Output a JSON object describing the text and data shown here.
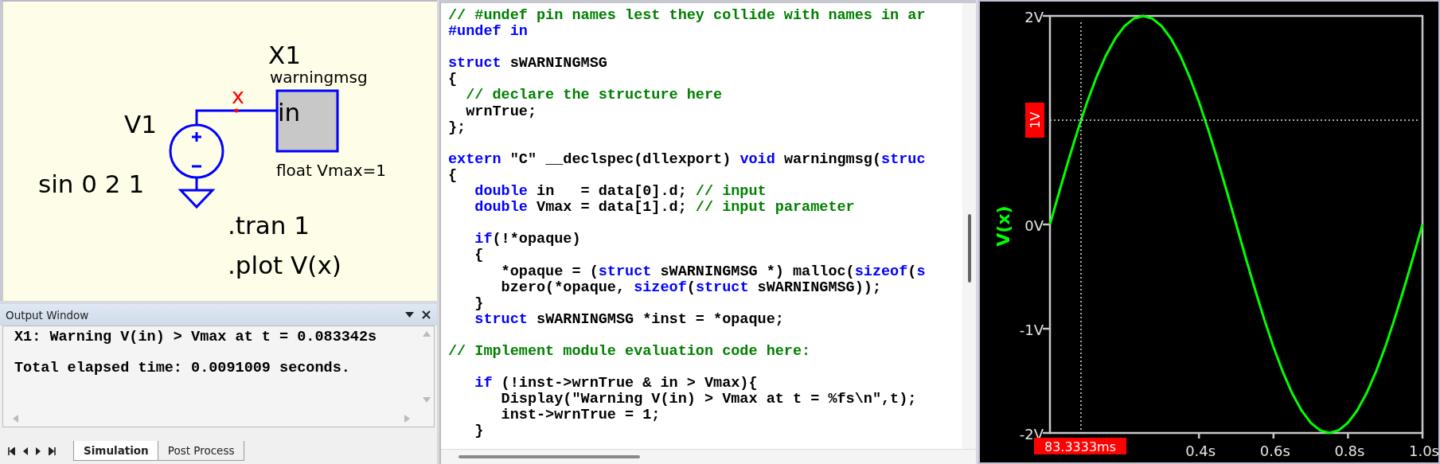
{
  "schematic": {
    "components": [
      {
        "kind": "voltage_source",
        "name": "V1",
        "value": "sin 0 2 1"
      },
      {
        "kind": "block",
        "name": "X1",
        "model": "warningmsg",
        "pin": "in",
        "params": "float Vmax=1"
      }
    ],
    "net_label": "x",
    "directives": [
      ".tran 1",
      ".plot V(x)"
    ]
  },
  "output_window": {
    "title": "Output Window",
    "lines": [
      "X1: Warning V(in) > Vmax at t = 0.083342s",
      "Total elapsed time: 0.0091009 seconds."
    ],
    "tabs": [
      {
        "label": "Simulation",
        "selected": true
      },
      {
        "label": "Post Process",
        "selected": false
      }
    ]
  },
  "code_editor": {
    "lines": [
      {
        "kind": "code",
        "tokens": [
          {
            "kind": "comment",
            "text": "// #undef pin names lest they collide with names in ar"
          }
        ]
      },
      {
        "kind": "code",
        "tokens": [
          {
            "kind": "keyword",
            "text": "#undef in"
          }
        ]
      },
      {
        "kind": "blank"
      },
      {
        "kind": "code",
        "tokens": [
          {
            "kind": "keyword",
            "text": "struct"
          },
          {
            "kind": "plain",
            "text": " sWARNINGMSG"
          }
        ]
      },
      {
        "kind": "code",
        "tokens": [
          {
            "kind": "plain",
            "text": "{"
          }
        ]
      },
      {
        "kind": "code",
        "tokens": [
          {
            "kind": "comment",
            "text": "  // declare the structure here"
          }
        ]
      },
      {
        "kind": "code",
        "tokens": [
          {
            "kind": "plain",
            "text": "  wrnTrue;"
          }
        ]
      },
      {
        "kind": "code",
        "tokens": [
          {
            "kind": "plain",
            "text": "};"
          }
        ]
      },
      {
        "kind": "blank"
      },
      {
        "kind": "code",
        "tokens": [
          {
            "kind": "keyword",
            "text": "extern"
          },
          {
            "kind": "plain",
            "text": " \"C\" __declspec(dllexport) "
          },
          {
            "kind": "keyword",
            "text": "void"
          },
          {
            "kind": "plain",
            "text": " warningmsg("
          },
          {
            "kind": "keyword",
            "text": "struc"
          }
        ]
      },
      {
        "kind": "code",
        "tokens": [
          {
            "kind": "plain",
            "text": "{"
          }
        ]
      },
      {
        "kind": "code",
        "tokens": [
          {
            "kind": "keyword",
            "text": "   double"
          },
          {
            "kind": "plain",
            "text": " in   = data[0].d; "
          },
          {
            "kind": "comment",
            "text": "// input"
          }
        ]
      },
      {
        "kind": "code",
        "tokens": [
          {
            "kind": "keyword",
            "text": "   double"
          },
          {
            "kind": "plain",
            "text": " Vmax = data[1].d; "
          },
          {
            "kind": "comment",
            "text": "// input parameter"
          }
        ]
      },
      {
        "kind": "blank"
      },
      {
        "kind": "code",
        "tokens": [
          {
            "kind": "keyword",
            "text": "   if"
          },
          {
            "kind": "plain",
            "text": "(!*opaque)"
          }
        ]
      },
      {
        "kind": "code",
        "tokens": [
          {
            "kind": "plain",
            "text": "   {"
          }
        ]
      },
      {
        "kind": "code",
        "tokens": [
          {
            "kind": "plain",
            "text": "      *opaque = ("
          },
          {
            "kind": "keyword",
            "text": "struct"
          },
          {
            "kind": "plain",
            "text": " sWARNINGMSG *) malloc("
          },
          {
            "kind": "keyword",
            "text": "sizeof"
          },
          {
            "kind": "plain",
            "text": "("
          },
          {
            "kind": "keyword",
            "text": "s"
          }
        ]
      },
      {
        "kind": "code",
        "tokens": [
          {
            "kind": "plain",
            "text": "      bzero(*opaque, "
          },
          {
            "kind": "keyword",
            "text": "sizeof"
          },
          {
            "kind": "plain",
            "text": "("
          },
          {
            "kind": "keyword",
            "text": "struct"
          },
          {
            "kind": "plain",
            "text": " sWARNINGMSG));"
          }
        ]
      },
      {
        "kind": "code",
        "tokens": [
          {
            "kind": "plain",
            "text": "   }"
          }
        ]
      },
      {
        "kind": "code",
        "tokens": [
          {
            "kind": "keyword",
            "text": "   struct"
          },
          {
            "kind": "plain",
            "text": " sWARNINGMSG *inst = *opaque;"
          }
        ]
      },
      {
        "kind": "blank"
      },
      {
        "kind": "code",
        "tokens": [
          {
            "kind": "comment",
            "text": "// Implement module evaluation code here:"
          }
        ]
      },
      {
        "kind": "blank"
      },
      {
        "kind": "code",
        "tokens": [
          {
            "kind": "keyword",
            "text": "   if"
          },
          {
            "kind": "plain",
            "text": " (!inst->wrnTrue & in > Vmax){"
          }
        ]
      },
      {
        "kind": "code",
        "tokens": [
          {
            "kind": "plain",
            "text": "      Display(\"Warning V(in) > Vmax at t = %fs\\n\",t);"
          }
        ]
      },
      {
        "kind": "code",
        "tokens": [
          {
            "kind": "plain",
            "text": "      inst->wrnTrue = 1;"
          }
        ]
      },
      {
        "kind": "code",
        "tokens": [
          {
            "kind": "plain",
            "text": "   }"
          }
        ]
      }
    ]
  },
  "plot": {
    "chart_data": {
      "type": "line",
      "x": [
        0,
        0.025,
        0.05,
        0.075,
        0.1,
        0.125,
        0.15,
        0.175,
        0.2,
        0.225,
        0.25,
        0.275,
        0.3,
        0.325,
        0.35,
        0.375,
        0.4,
        0.425,
        0.45,
        0.475,
        0.5,
        0.525,
        0.55,
        0.575,
        0.6,
        0.625,
        0.65,
        0.675,
        0.7,
        0.725,
        0.75,
        0.775,
        0.8,
        0.825,
        0.85,
        0.875,
        0.9,
        0.925,
        0.95,
        0.975,
        1
      ],
      "series": [
        {
          "name": "V(x)",
          "color": "#00ff00",
          "values": [
            0,
            0.313,
            0.618,
            0.908,
            1.176,
            1.414,
            1.618,
            1.782,
            1.902,
            1.975,
            2,
            1.975,
            1.902,
            1.782,
            1.618,
            1.414,
            1.176,
            0.908,
            0.618,
            0.313,
            0,
            -0.313,
            -0.618,
            -0.908,
            -1.176,
            -1.414,
            -1.618,
            -1.782,
            -1.902,
            -1.975,
            -2,
            -1.975,
            -1.902,
            -1.782,
            -1.618,
            -1.414,
            -1.176,
            -0.908,
            -0.618,
            -0.313,
            0
          ]
        }
      ],
      "xlim": [
        0,
        1
      ],
      "ylim": [
        -2,
        2
      ],
      "xticks": [
        {
          "value": 0.4,
          "label": "0.4s"
        },
        {
          "value": 0.6,
          "label": "0.6s"
        },
        {
          "value": 0.8,
          "label": "0.8s"
        },
        {
          "value": 1,
          "label": "1.0s"
        }
      ],
      "yticks": [
        {
          "value": -2,
          "label": "-2V"
        },
        {
          "value": -1,
          "label": "-1V"
        },
        {
          "value": 0,
          "label": "0V"
        },
        {
          "value": 2,
          "label": "2V"
        }
      ],
      "ref_lines": [
        {
          "axis": "x",
          "value": 0.0833333,
          "label": "83.3333ms"
        },
        {
          "axis": "y",
          "value": 1,
          "label": "1V"
        }
      ]
    }
  }
}
